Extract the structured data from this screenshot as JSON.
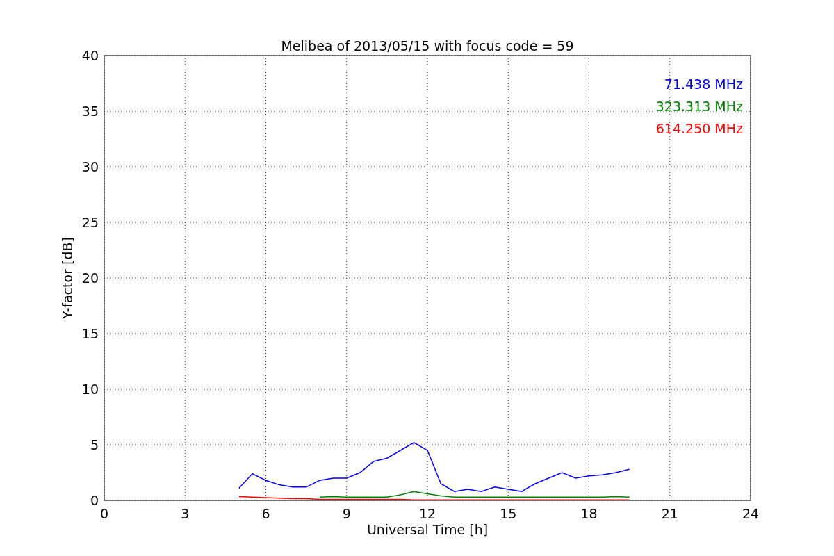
{
  "chart_data": {
    "type": "line",
    "title": "Melibea of 2013/05/15 with focus code = 59",
    "xlabel": "Universal Time [h]",
    "ylabel": "Y-factor [dB]",
    "x": [
      5,
      5.5,
      6,
      6.5,
      7,
      7.5,
      8,
      8.5,
      9,
      9.5,
      10,
      10.5,
      11,
      11.5,
      12,
      12.5,
      13,
      13.5,
      14,
      14.5,
      15,
      15.5,
      16,
      16.5,
      17,
      17.5,
      18,
      18.5,
      19,
      19.5
    ],
    "series": [
      {
        "name": "71.438 MHz",
        "color": "#0000ff",
        "values": [
          1.1,
          2.4,
          1.8,
          1.4,
          1.2,
          1.2,
          1.8,
          2.0,
          2.0,
          2.5,
          3.5,
          3.8,
          4.5,
          5.2,
          4.5,
          1.5,
          0.8,
          1.0,
          0.8,
          1.2,
          1.0,
          0.8,
          1.5,
          2.0,
          2.5,
          2.0,
          2.2,
          2.3,
          2.5,
          2.8
        ]
      },
      {
        "name": "323.313 MHz",
        "color": "#008000",
        "values": [
          null,
          null,
          null,
          null,
          null,
          null,
          0.3,
          0.35,
          0.3,
          0.3,
          0.3,
          0.3,
          0.5,
          0.8,
          0.6,
          0.4,
          0.3,
          0.3,
          0.3,
          0.3,
          0.3,
          0.3,
          0.3,
          0.3,
          0.3,
          0.3,
          0.3,
          0.3,
          0.35,
          0.3
        ]
      },
      {
        "name": "614.250 MHz",
        "color": "#ff0000",
        "values": [
          0.35,
          0.3,
          0.25,
          0.2,
          0.15,
          0.15,
          0.1,
          0.1,
          0.1,
          0.1,
          0.1,
          0.1,
          0.1,
          0.05,
          0.05,
          0.05,
          0.05,
          0.05,
          0.05,
          0.05,
          0.05,
          0.05,
          0.05,
          0.05,
          0.05,
          0.05,
          0.05,
          0.05,
          0.05,
          0.05
        ]
      }
    ],
    "grid": true,
    "xlim": [
      0,
      24
    ],
    "ylim": [
      0,
      40
    ],
    "xticks": [
      0,
      3,
      6,
      9,
      12,
      15,
      18,
      21,
      24
    ],
    "yticks": [
      0,
      5,
      10,
      15,
      20,
      25,
      30,
      35,
      40
    ]
  }
}
